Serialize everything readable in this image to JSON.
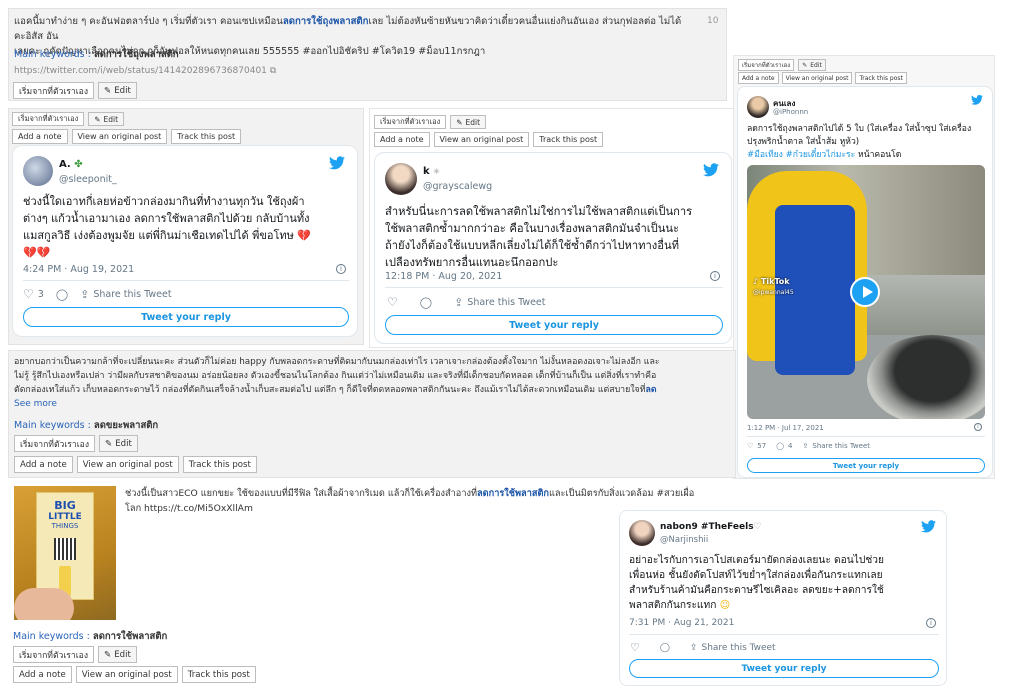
{
  "common": {
    "source_btn": "เริ่มจากที่ตัวเราเอง",
    "edit": "Edit",
    "add_note": "Add a note",
    "view_original": "View an original post",
    "track": "Track this post",
    "share": "Share this Tweet",
    "reply": "Tweet your reply",
    "kw_label": "Main keywords : "
  },
  "post1": {
    "text_a": "แอคนี้มาทำง่าย ๆ คะอันฟอตลาร์ปง ๆ เริ่มที่ตัวเรา คอนเซปเหมือน",
    "text_hl": "ลดการใช้ถุงพลาสติก",
    "text_b": "เลย ไม่ต้องหันซ้ายหันขวาคิดว่าเดี๋ยวคนอื่นแย่งกินอันเอง ส่วนกุฟอลต่อ ไม่ได้คะอิสัส อัน",
    "text_c": "เลยคะ ฤคัดปัญหาเลือกคนไม่ถูก กูก็อันฟอลให้หนดทุกคนเลย 555555 #ออกไปอิชัคริป #โควิด19 #ม็อบ11กรกฎา",
    "count": "10",
    "keyword": "ลดการใช้ถุงพลาสติก",
    "url": "https://twitter.com/i/web/status/1414202896736870401"
  },
  "tweet1": {
    "name": "A.",
    "handle": "@sleeponit_",
    "text1": "ช่วงนี้ใดเอาทกี่เลยห่อข้าวกล่องมากินที่ทำงานทุกวัน ใช้ถุงผ้า",
    "text2": "ต่างๆ แก้วน้ำเอามาเอง ลดการใช้พลาสติกไปด้วย กลับบ้านทั้ง",
    "text3": "แมสกูลวิธี เง่งต้องพูมจัย แต่พี่กินม่าเชือเทดไปได้ พี่ขอโทษ",
    "date": "4:24 PM · Aug 19, 2021",
    "likes": "3"
  },
  "tweet2": {
    "name": "k",
    "handle": "@grayscalewg",
    "text1": "สำหรับนี่นะการลดใช้พลาสติกไม่ใช่การไม่ใช้พลาสติกแต่เป็นการ",
    "text2": "ใช้พลาสติกซ้ำมากกว่าอะ คือในบางเรื่องพลาสติกมันจำเป็นนะ",
    "text3": "ถ้ายังไงก็ต้องใช้แบบหลีกเลี่ยงไม่ได้ก็ใช้ซ้ำดีกว่าไปหาทางอื่นที่",
    "text4": "เปลืองทรัพยากรอื่นแทนอะนึกออกปะ",
    "date": "12:18 PM · Aug 20, 2021"
  },
  "tweet3": {
    "name": "คนเลง",
    "handle": "@iPhonnn",
    "text1": "ลดการใช้ถุงพลาสติกไปได้ 5 ใบ (ใส่เครื่อง ใส่น้ำซุป ใส่เครื่อง",
    "text2": "ปรุงพริกน้ำตาล ใส่น้ำส้ม หูห้ว)",
    "tag1": "#มือเทียง",
    "tag2": "#ก๋วยเตี๋ยวไก่มะระ",
    "text3": "หน้าคอนโด",
    "tiktok": "TikTok",
    "tiktok_handle": "@ipwannal45",
    "date": "1:12 PM · Jul 17, 2021",
    "likes": "57",
    "replies": "4"
  },
  "post2": {
    "text1": "อยากบอกว่าเป็นความกล้าที่จะเปลี่ยนนะคะ ส่วนตัวก็ไม่ค่อย happy กับพลอดกระดาษที่ติดมากับนมกล่องเท่าไร เวลาเจาะกล่องต้องตั้งใจมาก ไม่งั้นหลอดงอเจาะไม่ลงอีก และ",
    "text2": "ไม่รู้ รู้สึกไปเองหรือเปล่า ว่ามีผลกับรสชาติของนม อร่อยน้อยลง ตัวเองขี้ชอนไนโลกต้อง กินแต่ว่าไม่เหมือนเดิม และจริงที่มีเด็กชอบกัดหลอด เด็กที่บ้านก็เป็น แต่สิ่งที่เราทำคือ",
    "text3": "ตัดกล่องเทใส่แก้ว เก็บหลอดกระดาษไว้ กล่องที่ตัดกินเสร็จล้างน้ำเก็บสะสมต่อไป แต่ลึก ๆ ก็ดีใจที่ตดหลอดพลาสติกกันนะคะ ถึงแม้เราไม่ได้สะดวกเหมือนเดิม แต่สบายใจที่",
    "text3_hl": "ลด",
    "see_more": "See more",
    "keyword": "ลดขยะพลาสติก"
  },
  "post3": {
    "text_a": "ช่วงนี้เป็นสาวECO แยกขยะ ใช้ของแบบที่มีรีฟิล ใส่เสื้อผ้าจากริเมด แล้วก็ใช้เครื่องสำอางที่",
    "text_hl": "ลดการใช้พลาสติก",
    "text_b": "และเป็นมิตรกับสิ่งแวดล้อม #สวยเผื่อ",
    "text_c": "โลก https://t.co/Mi5OxXllAm",
    "image_text1": "BIG",
    "image_text2": "LITTLE",
    "image_text3": "THINGS",
    "keyword": "ลดการใช้พลาสติก"
  },
  "tweet4": {
    "name": "nabon9",
    "name_tag": "#TheFeels",
    "handle": "@Narjinshii",
    "text1": "อย่าอะไรกับการเอาโปสเตอร์มายัดกล่องเลยนะ ดอนไปช่วย",
    "text2": "เพื่อนห่อ ชั้นยังตัดโปสท์ไว้ขย่ำๆใส่กล่องเพื่อกันกระแทกเลย",
    "text3": "สำหรับร้านค้ามันคือกระดาษรีไซเคิลอะ ลดขยะ+ลดการใช้",
    "text4": "พลาสติกกันกระแทก",
    "date": "7:31 PM · Aug 21, 2021"
  },
  "colors": {
    "twitter": "#1da1f2",
    "highlight": "#1f56a8",
    "panel": "#f2f2f2"
  },
  "icons": [
    "twitter-bird-icon",
    "heart-icon",
    "comment-icon",
    "share-icon",
    "info-icon",
    "pencil-icon",
    "external-link-icon",
    "play-icon",
    "broken-heart-icon",
    "clover-icon",
    "smile-emoji-icon"
  ]
}
